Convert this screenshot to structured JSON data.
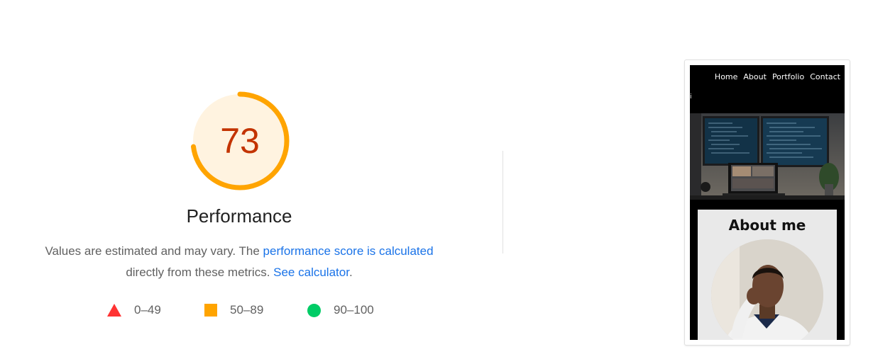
{
  "performance": {
    "score": "73",
    "score_value": 0.73,
    "title": "Performance",
    "description_prefix": "Values are estimated and may vary. The ",
    "link_score": "performance score is calculated",
    "description_mid": " directly from these metrics. ",
    "link_calculator": "See calculator",
    "description_suffix": ".",
    "colors": {
      "score_text": "#c33300",
      "arc": "#ffa400",
      "track": "#fff3e0",
      "link": "#1a73e8"
    }
  },
  "legend": [
    {
      "icon": "fail-triangle-icon",
      "label": "0–49",
      "color": "#ff3333"
    },
    {
      "icon": "average-square-icon",
      "label": "50–89",
      "color": "#ffa400"
    },
    {
      "icon": "pass-circle-icon",
      "label": "90–100",
      "color": "#00cc66"
    }
  ],
  "screenshot": {
    "nav": [
      "Home",
      "About",
      "Portfolio",
      "Contact"
    ],
    "nav_stub": "i",
    "about_title": "About me"
  }
}
